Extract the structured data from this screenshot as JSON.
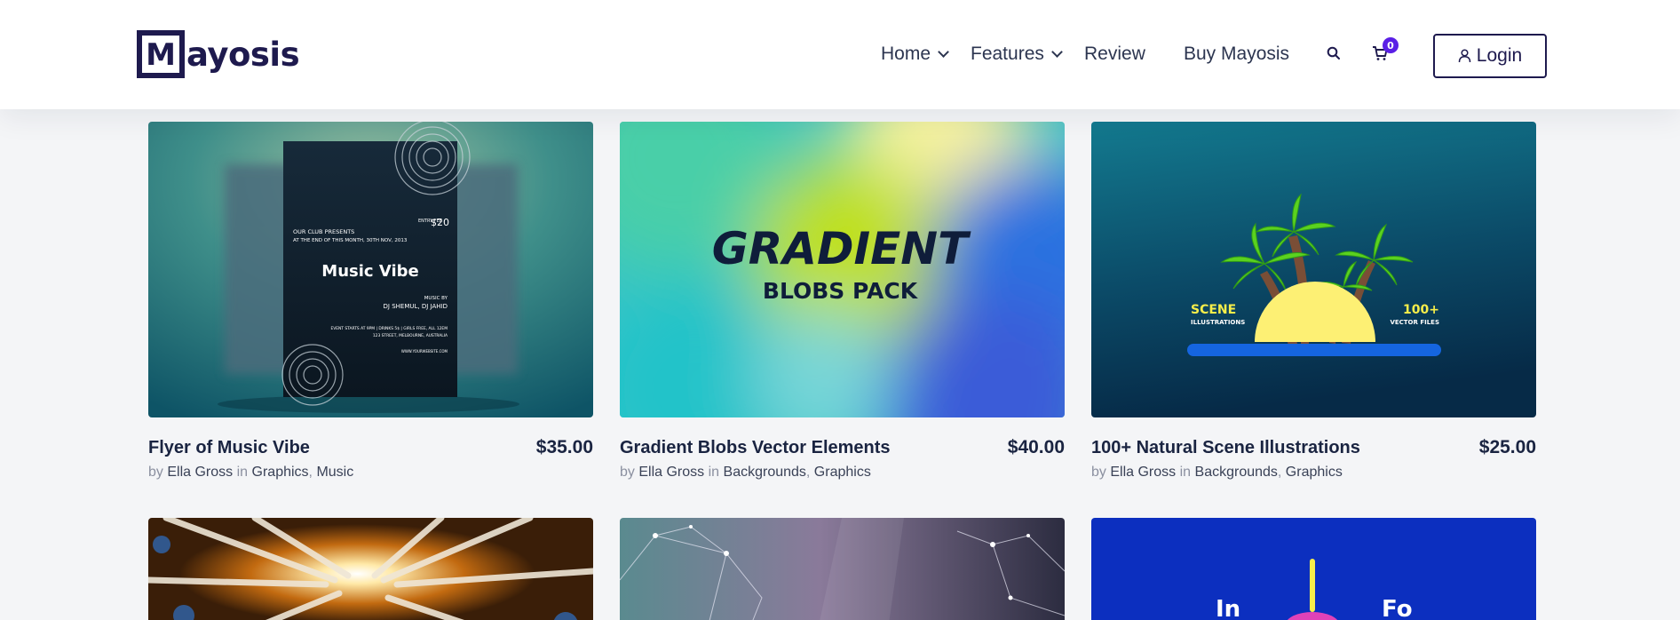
{
  "brand": {
    "logo_letter": "M",
    "logo_text": "ayosis"
  },
  "nav": {
    "home": "Home",
    "features": "Features",
    "review": "Review",
    "buy": "Buy Mayosis"
  },
  "cart": {
    "count": "0"
  },
  "login": {
    "label": "Login"
  },
  "products": [
    {
      "title": "Flyer of Music Vibe",
      "price": "$35.00",
      "by": "by",
      "author": "Ella Gross",
      "in": "in",
      "categories": [
        "Graphics",
        "Music"
      ],
      "art": {
        "club": "OUR CLUB PRESENTS",
        "date": "AT THE END OF THIS MONTH, 30TH NOV, 2013",
        "entry": "ENTRY FEE",
        "fee": "$20",
        "headline": "Music Vibe",
        "music_by": "MUSIC BY",
        "djs": "DJ SHEMUL, DJ JAHID",
        "event": "EVENT STARTS AT 9PM  |  DRINKS 5$  |  GIRLS FREE, ALL 12EM",
        "address": "123 STREET, MELBOURNE, AUSTRALIA",
        "site": "WWW.YOURWEBSITE.COM"
      }
    },
    {
      "title": "Gradient Blobs Vector Elements",
      "price": "$40.00",
      "by": "by",
      "author": "Ella Gross",
      "in": "in",
      "categories": [
        "Backgrounds",
        "Graphics"
      ],
      "art": {
        "headline": "GRADIENT",
        "sub": "BLOBS PACK"
      }
    },
    {
      "title": "100+ Natural Scene Illustrations",
      "price": "$25.00",
      "by": "by",
      "author": "Ella Gross",
      "in": "in",
      "categories": [
        "Backgrounds",
        "Graphics"
      ],
      "art": {
        "left_big": "SCENE",
        "left_small": "ILLUSTRATIONS",
        "right_big": "100+",
        "right_small": "VECTOR FILES"
      }
    }
  ],
  "row2": {
    "right_art": {
      "left": "In",
      "right": "Fo"
    }
  },
  "colors": {
    "brand": "#1e1a4e",
    "badge": "#5a1fe6",
    "text": "#1a2441",
    "muted": "#8b90a0"
  },
  "icons": [
    "search-icon",
    "cart-icon",
    "user-icon",
    "chevron-down-icon"
  ]
}
